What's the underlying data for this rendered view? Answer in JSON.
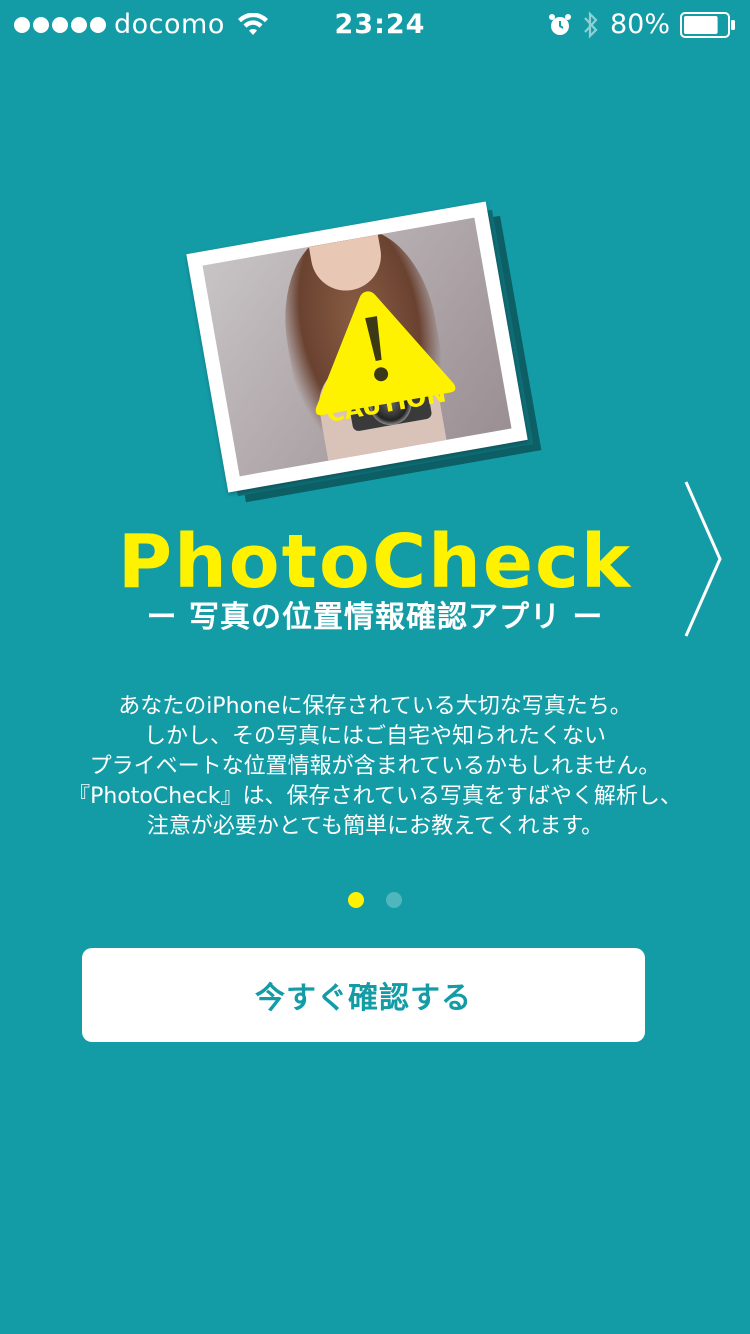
{
  "status_bar": {
    "carrier": "docomo",
    "time": "23:24",
    "battery_percent": "80%",
    "battery_level": 0.8,
    "signal_bars": 5,
    "icons": [
      "wifi-icon",
      "alarm-icon",
      "bluetooth-icon",
      "battery-icon"
    ]
  },
  "hero": {
    "caution_label": "CAUTION",
    "icon": "caution-icon"
  },
  "title": "PhotoCheck",
  "subtitle": "ー 写真の位置情報確認アプリ ー",
  "description": [
    "あなたのiPhoneに保存されている大切な写真たち。",
    "しかし、その写真にはご自宅や知られたくない",
    "プライベートな位置情報が含まれているかもしれません。",
    "『PhotoCheck』は、保存されている写真をすばやく解析し、",
    "注意が必要かとても簡単にお教えてくれます。"
  ],
  "pagination": {
    "total": 2,
    "current": 1
  },
  "cta": {
    "label": "今すぐ確認する"
  },
  "colors": {
    "background": "#149ca6",
    "accent_yellow": "#fff200",
    "text": "#ffffff",
    "button_bg": "#ffffff",
    "button_text": "#149ca6"
  }
}
